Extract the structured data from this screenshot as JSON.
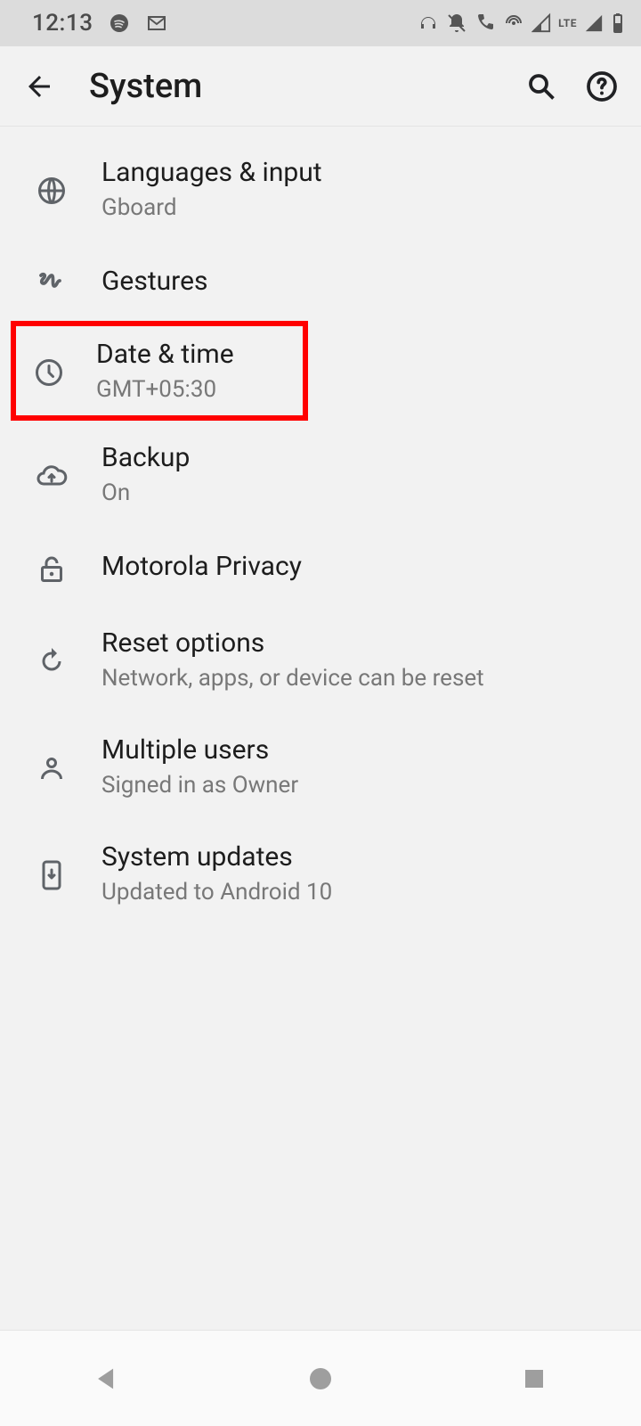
{
  "statusbar": {
    "time": "12:13",
    "lte_label": "LTE"
  },
  "appbar": {
    "title": "System"
  },
  "settings": [
    {
      "title": "Languages & input",
      "sub": "Gboard"
    },
    {
      "title": "Gestures",
      "sub": ""
    },
    {
      "title": "Date & time",
      "sub": "GMT+05:30"
    },
    {
      "title": "Backup",
      "sub": "On"
    },
    {
      "title": "Motorola Privacy",
      "sub": ""
    },
    {
      "title": "Reset options",
      "sub": "Network, apps, or device can be reset"
    },
    {
      "title": "Multiple users",
      "sub": "Signed in as Owner"
    },
    {
      "title": "System updates",
      "sub": "Updated to Android 10"
    }
  ]
}
